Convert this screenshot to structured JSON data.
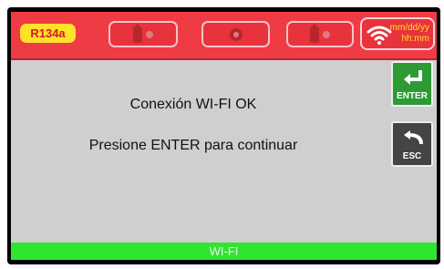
{
  "refrigerant": "R134a",
  "datetime": {
    "date": "mm/dd/yy",
    "time": "hh:mm"
  },
  "message": {
    "line1": "Conexión WI-FI OK",
    "line2": "Presione ENTER para continuar"
  },
  "buttons": {
    "enter": "ENTER",
    "esc": "ESC"
  },
  "status": "WI-FI",
  "icons": [
    "recover-icon",
    "vacuum-icon",
    "charge-icon",
    "wifi-icon",
    "enter-arrow-icon",
    "back-arrow-icon"
  ]
}
